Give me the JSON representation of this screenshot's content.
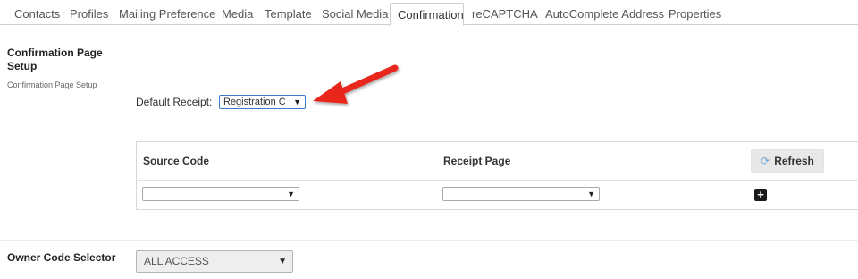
{
  "tabs": [
    {
      "label": "Contacts"
    },
    {
      "label": "Profiles"
    },
    {
      "label": "Mailing Preference"
    },
    {
      "label": "Media"
    },
    {
      "label": "Template"
    },
    {
      "label": "Social Media"
    },
    {
      "label": "Confirmation",
      "active": true
    },
    {
      "label": "reCAPTCHA"
    },
    {
      "label": "AutoComplete Address"
    },
    {
      "label": "Properties"
    }
  ],
  "section": {
    "title": "Confirmation Page Setup",
    "subtitle": "Confirmation Page Setup",
    "default_receipt_label": "Default Receipt:",
    "default_receipt_value": "Registration C"
  },
  "table": {
    "headers": {
      "source_code": "Source Code",
      "receipt_page": "Receipt Page"
    },
    "refresh_label": "Refresh",
    "row": {
      "source_code_value": "",
      "receipt_page_value": ""
    }
  },
  "owner": {
    "label": "Owner Code Selector",
    "value": "ALL ACCESS"
  },
  "icons": {
    "dropdown": "chevron-down-icon",
    "refresh": "refresh-icon",
    "add": "plus-square-icon",
    "annotation": "red-arrow"
  },
  "colors": {
    "arrow": "#e8261a",
    "add_button": "#1a1a1a",
    "refresh_icon": "#74a9d6",
    "focus_border": "#3a78c8"
  }
}
